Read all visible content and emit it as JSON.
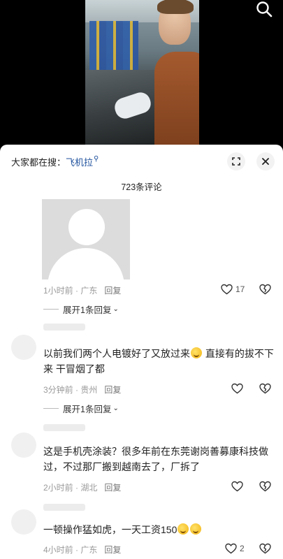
{
  "header": {
    "search_icon": "search-icon"
  },
  "sheet": {
    "everyone_search_label": "大家都在搜：",
    "search_keyword": "飞机拉",
    "keyword_icon": "search-icon",
    "expand_icon": "expand-icon",
    "close_icon": "close-icon",
    "comment_count": "723条评论"
  },
  "comments": [
    {
      "text": "",
      "meta": "1小时前 · 广东",
      "reply": "回复",
      "likes": "17",
      "expand": "展开1条回复"
    },
    {
      "text_before_emoji": "以前我们两个人电镀好了又放过来",
      "text_after_emoji": " 直接有的拔不下来  干冒烟了都",
      "meta": "3分钟前 · 贵州",
      "reply": "回复",
      "likes": "",
      "expand": "展开1条回复"
    },
    {
      "text": "这是手机壳涂装？很多年前在东莞谢岗善募康科技做过，不过那厂搬到越南去了，厂拆了",
      "meta": "2小时前 · 湖北",
      "reply": "回复",
      "likes": ""
    },
    {
      "text": "一顿操作猛如虎，一天工资150",
      "meta": "4小时前 · 广东",
      "reply": "回复",
      "likes": "2"
    }
  ],
  "colors": {
    "keyword": "#1c4f9c",
    "meta": "#9a9a9a"
  }
}
